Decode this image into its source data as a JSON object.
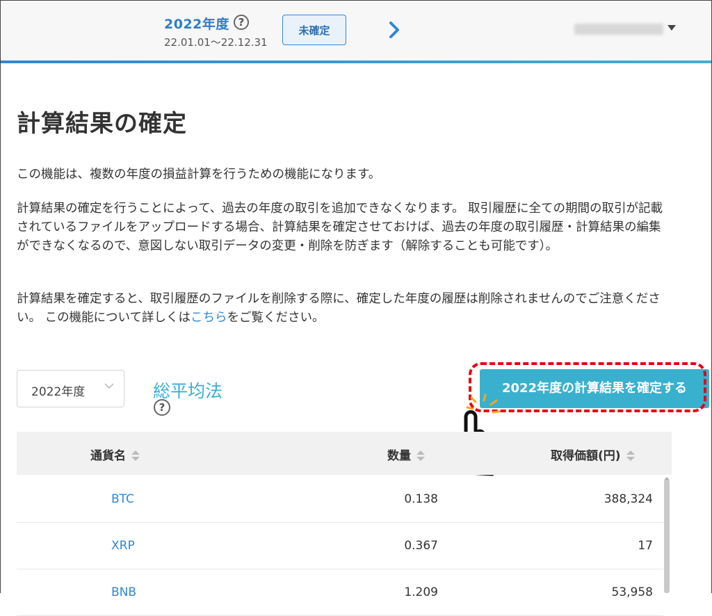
{
  "header": {
    "fiscal_year": "2022年度",
    "help_icon": "?",
    "date_range": "22.01.01～22.12.31",
    "status_button": "未確定",
    "next_icon": "chevron-right-icon",
    "account_caret_icon": "caret-down-icon"
  },
  "page": {
    "title": "計算結果の確定",
    "para1": "この機能は、複数の年度の損益計算を行うための機能になります。",
    "para2": "計算結果の確定を行うことによって、過去の年度の取引を追加できなくなります。 取引履歴に全ての期間の取引が記載されているファイルをアップロードする場合、計算結果を確定させておけば、過去の年度の取引履歴・計算結果の編集ができなくなるので、意図しない取引データの変更・削除を防ぎます（解除することも可能です）。",
    "para3_before": "計算結果を確定すると、取引履歴のファイルを削除する際に、確定した年度の履歴は削除されませんのでご注意ください。 この機能について詳しくは",
    "para3_link": "こちら",
    "para3_after": "をご覧ください。"
  },
  "controls": {
    "year_select_value": "2022年度",
    "method_label": "総平均法",
    "method_help": "?",
    "confirm_button": "2022年度の計算結果を確定する"
  },
  "table": {
    "headers": {
      "currency": "通貨名",
      "quantity": "数量",
      "cost": "取得価額(円)"
    },
    "rows": [
      {
        "currency": "BTC",
        "quantity": "0.138",
        "cost": "388,324"
      },
      {
        "currency": "XRP",
        "quantity": "0.367",
        "cost": "17"
      },
      {
        "currency": "BNB",
        "quantity": "1.209",
        "cost": "53,958"
      }
    ]
  },
  "colors": {
    "accent_blue": "#2f87d6",
    "button_teal": "#3ab0cf",
    "highlight_red": "#e60012"
  }
}
